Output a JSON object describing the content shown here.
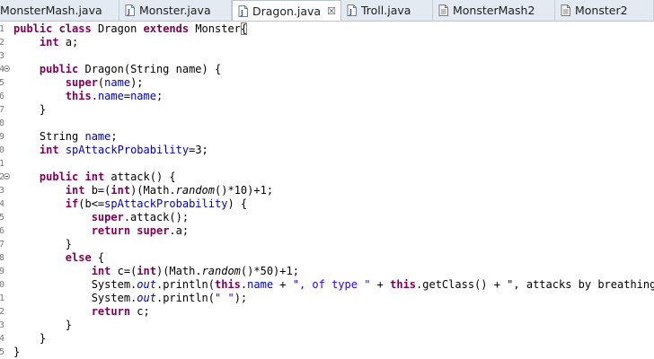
{
  "tabs": [
    {
      "label": "MonsterMash.java",
      "icon": "java-file-icon",
      "active": false
    },
    {
      "label": "Monster.java",
      "icon": "java-file-icon",
      "active": false
    },
    {
      "label": "Dragon.java",
      "icon": "java-file-icon",
      "active": true,
      "close": "☒"
    },
    {
      "label": "Troll.java",
      "icon": "java-file-icon",
      "active": false
    },
    {
      "label": "MonsterMash2",
      "icon": "class-file-icon",
      "active": false
    },
    {
      "label": "Monster2",
      "icon": "class-file-icon",
      "active": false
    }
  ],
  "line_numbers": [
    "1",
    "2",
    "3",
    "4",
    "5",
    "6",
    "7",
    "8",
    "9",
    "0",
    "1",
    "2",
    "3",
    "4",
    "5",
    "6",
    "7",
    "8",
    "9",
    "0",
    "1",
    "2",
    "3",
    "4",
    "5"
  ],
  "code": [
    "public class Dragon extends Monster{",
    "    int a;",
    "",
    "    public Dragon(String name) {",
    "        super(name);",
    "        this.name=name;",
    "    }",
    "",
    "    String name;",
    "    int spAttackProbability=3;",
    "",
    "    public int attack() {",
    "        int b=(int)(Math.random()*10)+1;",
    "        if(b<=spAttackProbability) {",
    "            super.attack();",
    "            return super.a;",
    "        }",
    "        else {",
    "            int c=(int)(Math.random()*50)+1;",
    "            System.out.println(this.name + \", of type \" + this.getClass() + \", attacks by breathing fi",
    "            System.out.println(\" \");",
    "            return c;",
    "        }",
    "    }",
    "}"
  ],
  "colors": {
    "keyword": "#7f0055",
    "field": "#0000c0",
    "string": "#2a00ff",
    "tab_bar": "#e4eaf2"
  }
}
